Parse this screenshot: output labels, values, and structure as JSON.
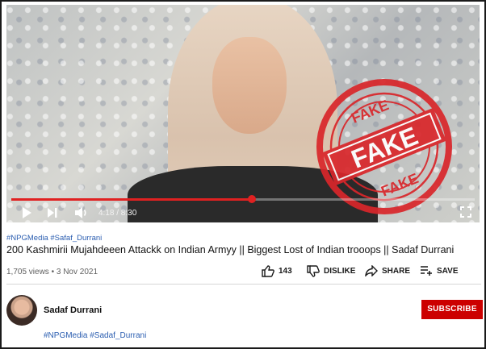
{
  "video": {
    "timecode": "4:18 / 8:30",
    "progress": 0.52,
    "stamp_text": "FAKE",
    "accent_color": "#e02121"
  },
  "info": {
    "hashtags_top": "#NPGMedia #Safaf_Durrani",
    "title": "200 Kashmirii Mujahdeeen Attackk on Indian Armyy || Biggest Lost of Indian trooops || Sadaf Durrani",
    "views_date": "1,705 views • 3 Nov 2021"
  },
  "actions": {
    "like_count": "143",
    "dislike_label": "DISLIKE",
    "share_label": "SHARE",
    "save_label": "SAVE"
  },
  "channel": {
    "name": "Sadaf Durrani",
    "subscribe_label": "SUBSCRIBE",
    "hashtags_bottom": "#NPGMedia #Sadaf_Durrani",
    "subscribe_color": "#cc0000"
  },
  "icons": [
    "play-icon",
    "skip-next-icon",
    "volume-icon",
    "fullscreen-icon",
    "thumbs-up-icon",
    "thumbs-down-icon",
    "share-icon",
    "save-to-playlist-icon"
  ]
}
